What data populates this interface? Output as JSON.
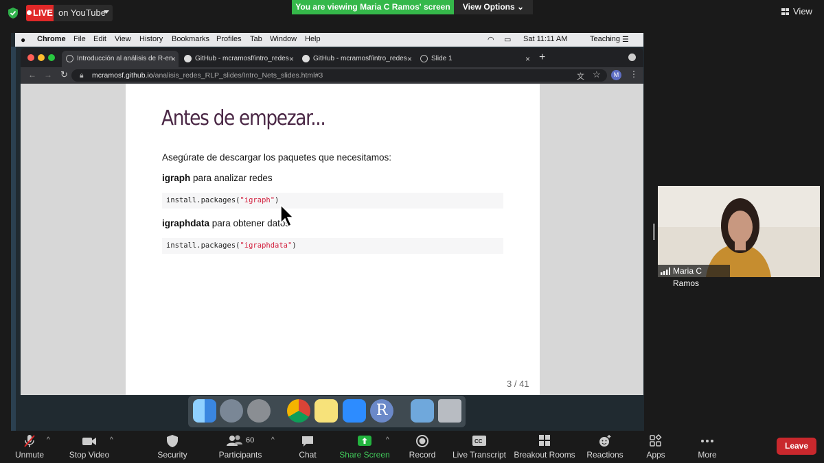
{
  "zoom_top": {
    "live_label": "LIVE",
    "live_destination": "on YouTube",
    "viewing_banner": "You are viewing Maria C Ramos' screen",
    "view_options_label": "View Options",
    "view_label": "View"
  },
  "mac_menubar": {
    "app": "Chrome",
    "items": [
      "File",
      "Edit",
      "View",
      "History",
      "Bookmarks",
      "Profiles",
      "Tab",
      "Window",
      "Help"
    ],
    "clock": "Sat 11:11 AM",
    "user": "Teaching"
  },
  "browser": {
    "tabs": [
      {
        "label": "Introducción al análisis de R-en",
        "icon": "globe-icon",
        "active": true
      },
      {
        "label": "GitHub - mcramosf/intro_redes",
        "icon": "github-icon",
        "active": false
      },
      {
        "label": "GitHub - mcramosf/intro_redes",
        "icon": "github-icon",
        "active": false
      },
      {
        "label": "Slide 1",
        "icon": "globe-icon",
        "active": false
      }
    ],
    "url_host": "mcramosf.github.io",
    "url_path": "/analisis_redes_RLP_slides/Intro_Nets_slides.html#3",
    "profile_initial": "M"
  },
  "slide": {
    "title": "Antes de empezar...",
    "intro": "Asegúrate de descargar los paquetes que necesitamos:",
    "pkg1_name": "igraph",
    "pkg1_desc": " para analizar redes",
    "pkg1_code_fn": "install.packages(",
    "pkg1_code_str": "\"igraph\"",
    "pkg1_code_end": ")",
    "pkg2_name": "igraphdata",
    "pkg2_desc": " para obtener datos",
    "pkg2_code_fn": "install.packages(",
    "pkg2_code_str": "\"igraphdata\"",
    "pkg2_code_end": ")",
    "page_number": "3 / 41"
  },
  "participant": {
    "name": "Maria C Ramos"
  },
  "toolbar": {
    "unmute": "Unmute",
    "stop_video": "Stop Video",
    "security": "Security",
    "participants": "Participants",
    "participants_count": "60",
    "chat": "Chat",
    "share_screen": "Share Screen",
    "record": "Record",
    "live_transcript": "Live Transcript",
    "breakout_rooms": "Breakout Rooms",
    "reactions": "Reactions",
    "apps": "Apps",
    "more": "More",
    "leave": "Leave"
  },
  "colors": {
    "live_red": "#e02828",
    "banner_green": "#35b84a",
    "slide_title_purple": "#4b2846",
    "code_string_red": "#d21e3c",
    "leave_red": "#c9282d",
    "share_green": "#23b43f"
  }
}
